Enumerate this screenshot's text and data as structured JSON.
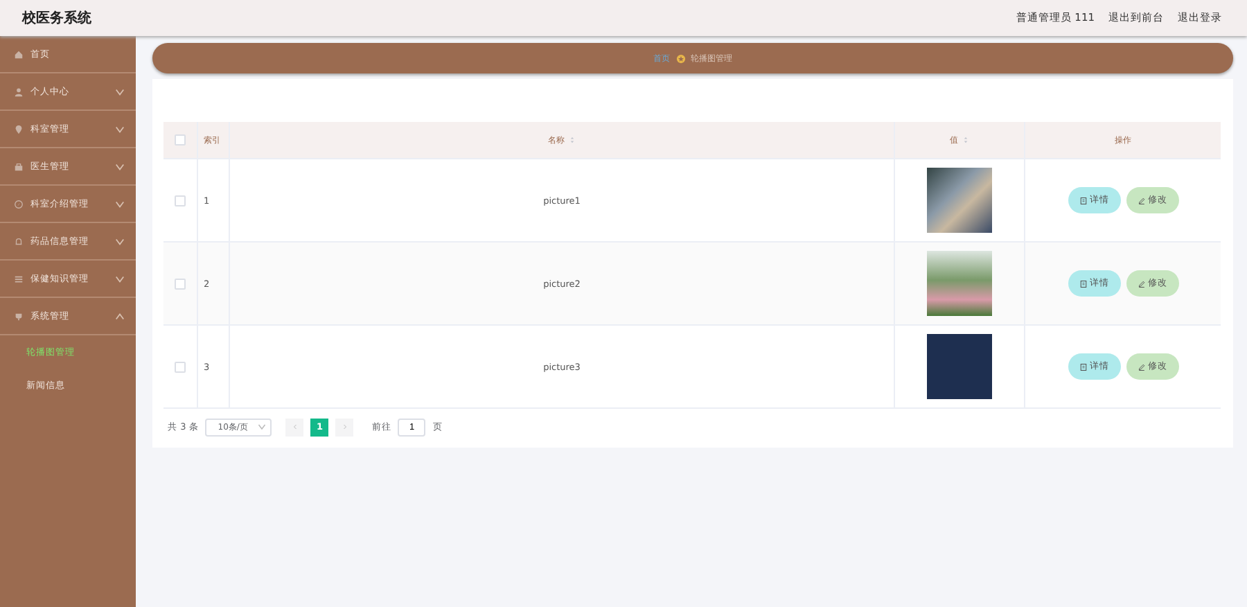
{
  "header": {
    "title": "校医务系统",
    "links": [
      "普通管理员 111",
      "退出到前台",
      "退出登录"
    ]
  },
  "sidebar": {
    "items": [
      {
        "label": "首页",
        "expandable": false
      },
      {
        "label": "个人中心",
        "expandable": true,
        "expanded": false
      },
      {
        "label": "科室管理",
        "expandable": true,
        "expanded": false
      },
      {
        "label": "医生管理",
        "expandable": true,
        "expanded": false
      },
      {
        "label": "科室介绍管理",
        "expandable": true,
        "expanded": false
      },
      {
        "label": "药品信息管理",
        "expandable": true,
        "expanded": false
      },
      {
        "label": "保健知识管理",
        "expandable": true,
        "expanded": false
      },
      {
        "label": "系统管理",
        "expandable": true,
        "expanded": true,
        "children": [
          {
            "label": "轮播图管理",
            "selected": true
          },
          {
            "label": "新闻信息",
            "selected": false
          }
        ]
      }
    ]
  },
  "breadcrumb": [
    "首页",
    "轮播图管理"
  ],
  "table": {
    "all_checked": false,
    "columns": [
      {
        "label": "索引",
        "sortable": false
      },
      {
        "label": "名称",
        "sortable": true
      },
      {
        "label": "值",
        "sortable": true
      },
      {
        "label": "操作",
        "sortable": false
      }
    ],
    "rows": [
      {
        "index": "1",
        "name": "picture1",
        "checked": false,
        "actions": [
          "详情",
          "修改"
        ]
      },
      {
        "index": "2",
        "name": "picture2",
        "checked": false,
        "actions": [
          "详情",
          "修改"
        ]
      },
      {
        "index": "3",
        "name": "picture3",
        "checked": false,
        "actions": [
          "详情",
          "修改"
        ]
      }
    ]
  },
  "pagination": {
    "total": "共 3 条",
    "page_size": "10条/页",
    "pages": [
      {
        "label": "1",
        "selected": true
      }
    ],
    "goto_label": "前往",
    "goto_value": "1",
    "goto_suffix": "页"
  }
}
